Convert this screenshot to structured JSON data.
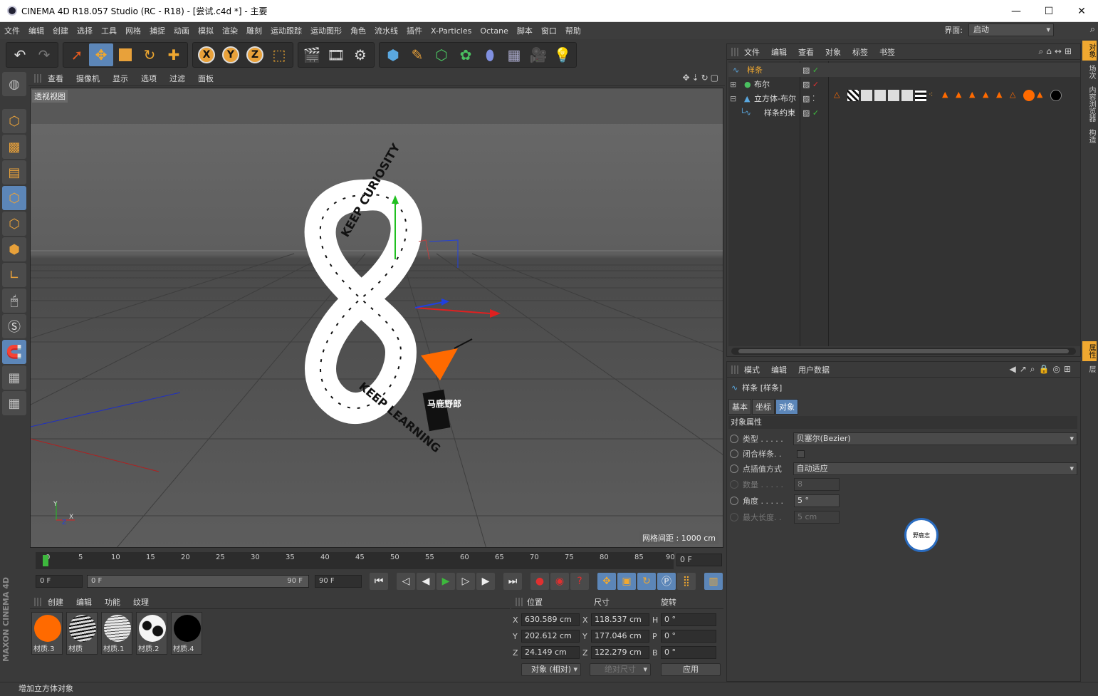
{
  "window": {
    "title": "CINEMA 4D R18.057 Studio (RC - R18) - [尝试.c4d *] - 主要",
    "min": "—",
    "max": "☐",
    "close": "✕"
  },
  "menu": {
    "items": [
      "文件",
      "编辑",
      "创建",
      "选择",
      "工具",
      "网格",
      "捕捉",
      "动画",
      "模拟",
      "渲染",
      "雕刻",
      "运动跟踪",
      "运动图形",
      "角色",
      "流水线",
      "插件",
      "X-Particles",
      "Octane",
      "脚本",
      "窗口",
      "帮助"
    ],
    "layout_label": "界面:",
    "layout_value": "启动"
  },
  "viewport": {
    "menu": [
      "查看",
      "摄像机",
      "显示",
      "选项",
      "过滤",
      "面板"
    ],
    "label": "透视视图",
    "grid_spacing": "网格间距 : 1000 cm",
    "nav_icons": "✥⇣↻▢"
  },
  "timeline": {
    "ticks": [
      "0",
      "5",
      "10",
      "15",
      "20",
      "25",
      "30",
      "35",
      "40",
      "45",
      "50",
      "55",
      "60",
      "65",
      "70",
      "75",
      "80",
      "85",
      "90"
    ],
    "current_frame": "0 F"
  },
  "transport": {
    "start": "0 F",
    "range_start": "0 F",
    "range_end": "90 F",
    "end": "90 F"
  },
  "materials": {
    "menu": [
      "创建",
      "编辑",
      "功能",
      "纹理"
    ],
    "items": [
      {
        "name": "材质.3",
        "color": "#ff6a00"
      },
      {
        "name": "材质",
        "color": "#d8d8d8"
      },
      {
        "name": "材质.1",
        "color": "#e8e8e8"
      },
      {
        "name": "材质.2",
        "color": "#f4f4f4"
      },
      {
        "name": "材质.4",
        "color": "#000000"
      }
    ]
  },
  "coords": {
    "headers": [
      "位置",
      "尺寸",
      "旋转"
    ],
    "rows": [
      {
        "axis": "X",
        "pos": "630.589 cm",
        "size_axis": "X",
        "size": "118.537 cm",
        "rot_axis": "H",
        "rot": "0 °"
      },
      {
        "axis": "Y",
        "pos": "202.612 cm",
        "size_axis": "Y",
        "size": "177.046 cm",
        "rot_axis": "P",
        "rot": "0 °"
      },
      {
        "axis": "Z",
        "pos": "24.149 cm",
        "size_axis": "Z",
        "size": "122.279 cm",
        "rot_axis": "B",
        "rot": "0 °"
      }
    ],
    "mode": "对象 (相对)",
    "size_mode": "绝对尺寸",
    "apply": "应用"
  },
  "object_manager": {
    "menu": [
      "文件",
      "编辑",
      "查看",
      "对象",
      "标签",
      "书签"
    ],
    "objects": [
      {
        "name": "样条",
        "selected": true
      },
      {
        "name": "布尔",
        "selected": false
      },
      {
        "name": "立方体-布尔",
        "selected": false
      },
      {
        "name": "样条约束",
        "selected": false
      }
    ]
  },
  "attribute_manager": {
    "menu": [
      "模式",
      "编辑",
      "用户数据"
    ],
    "object_title": "样条 [样条]",
    "tabs": [
      "基本",
      "坐标",
      "对象"
    ],
    "section": "对象属性",
    "fields": [
      {
        "label": "类型 . . . . .",
        "value": "贝塞尔(Bezier)"
      },
      {
        "label": "闭合样条. .",
        "value": ""
      },
      {
        "label": "点插值方式",
        "value": "自动适应"
      },
      {
        "label": "数量 . . . . .",
        "value": "8"
      },
      {
        "label": "角度 . . . . .",
        "value": "5 °"
      },
      {
        "label": "最大长度. .",
        "value": "5 cm"
      }
    ]
  },
  "right_tabs": [
    "对象",
    "场次",
    "内容浏览器",
    "构造",
    "属性",
    "层"
  ],
  "status": "增加立方体对象",
  "brand": "MAXON CINEMA 4D",
  "watermark": "野鹿志",
  "text_graphic": {
    "line1": "KEEP CURIOSITY",
    "line2": "KEEP LEARNING",
    "badge": "马鹿野郎"
  },
  "colors": {
    "accent": "#5c86b8",
    "selected": "#f0a830",
    "axis_x": "#e02020",
    "axis_y": "#20c020",
    "axis_z": "#2040e0"
  }
}
